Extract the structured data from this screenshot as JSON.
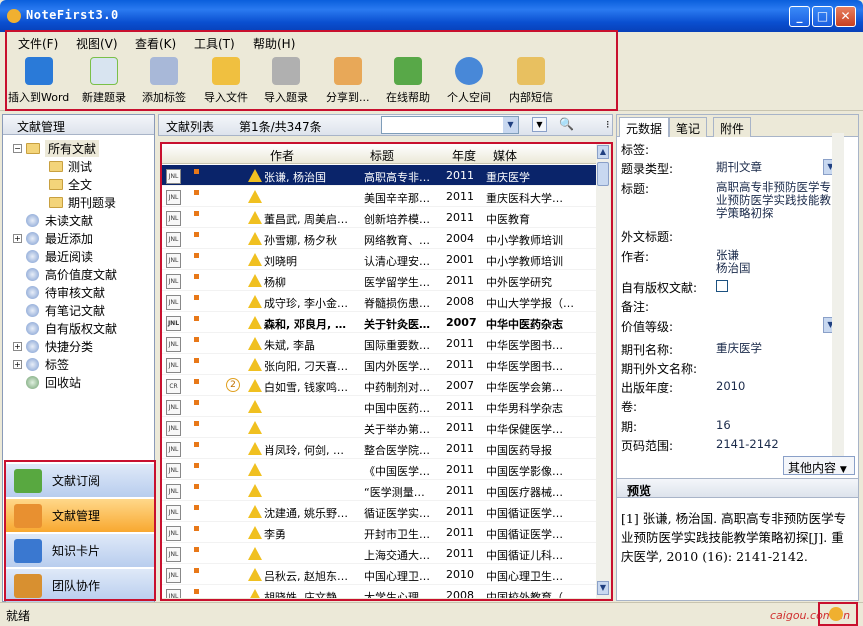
{
  "window": {
    "title": "NoteFirst3.0"
  },
  "menu": [
    "文件(F)",
    "视图(V)",
    "查看(K)",
    "工具(T)",
    "帮助(H)"
  ],
  "toolbar": [
    {
      "label": "插入到Word",
      "icon": "word-insert-icon",
      "color": "#2a7ad8"
    },
    {
      "label": "新建题录",
      "icon": "new-record-icon",
      "color": "#7ac048"
    },
    {
      "label": "添加标签",
      "icon": "tag-icon",
      "color": "#a8b8d8"
    },
    {
      "label": "导入文件",
      "icon": "import-file-icon",
      "color": "#f0c040"
    },
    {
      "label": "导入题录",
      "icon": "import-record-icon",
      "color": "#b0b0b0"
    },
    {
      "label": "分享到...",
      "icon": "share-icon",
      "color": "#e8a858"
    },
    {
      "label": "在线帮助",
      "icon": "help-icon",
      "color": "#58a848"
    },
    {
      "label": "个人空间",
      "icon": "personal-space-icon",
      "color": "#4888d8"
    },
    {
      "label": "内部短信",
      "icon": "message-icon",
      "color": "#e8c060"
    }
  ],
  "left": {
    "header": "文献管理",
    "tree": [
      {
        "label": "所有文献",
        "level": 0,
        "type": "folder",
        "expander": "−"
      },
      {
        "label": "测试",
        "level": 1,
        "type": "folder",
        "expander": ""
      },
      {
        "label": "全文",
        "level": 1,
        "type": "folder",
        "expander": ""
      },
      {
        "label": "期刊题录",
        "level": 1,
        "type": "folder",
        "expander": ""
      },
      {
        "label": "未读文献",
        "level": 0,
        "type": "star",
        "expander": ""
      },
      {
        "label": "最近添加",
        "level": 0,
        "type": "star",
        "expander": "+"
      },
      {
        "label": "最近阅读",
        "level": 0,
        "type": "star",
        "expander": ""
      },
      {
        "label": "高价值度文献",
        "level": 0,
        "type": "star",
        "expander": ""
      },
      {
        "label": "待审核文献",
        "level": 0,
        "type": "star",
        "expander": ""
      },
      {
        "label": "有笔记文献",
        "level": 0,
        "type": "star",
        "expander": ""
      },
      {
        "label": "自有版权文献",
        "level": 0,
        "type": "star",
        "expander": ""
      },
      {
        "label": "快捷分类",
        "level": 0,
        "type": "star",
        "expander": "+"
      },
      {
        "label": "标签",
        "level": 0,
        "type": "star",
        "expander": "+"
      },
      {
        "label": "回收站",
        "level": 0,
        "type": "trash",
        "expander": ""
      }
    ],
    "nav": [
      {
        "label": "文献订阅",
        "active": false
      },
      {
        "label": "文献管理",
        "active": true
      },
      {
        "label": "知识卡片",
        "active": false
      },
      {
        "label": "团队协作",
        "active": false
      }
    ]
  },
  "list": {
    "title": "文献列表",
    "count": "第1条/共347条",
    "columns": {
      "author": "作者",
      "title": "标题",
      "year": "年度",
      "media": "媒体"
    },
    "rows": [
      {
        "type": "JNL",
        "author": "张谦, 杨治国",
        "title": "高职高专非…",
        "year": "2011",
        "media": "重庆医学",
        "sel": true
      },
      {
        "type": "JNL",
        "author": "",
        "title": "美国辛辛那…",
        "year": "2011",
        "media": "重庆医科大学…"
      },
      {
        "type": "JNL",
        "author": "董昌武, 周美启…",
        "title": "创新培养模…",
        "year": "2011",
        "media": "中医教育"
      },
      {
        "type": "JNL",
        "author": "孙雪娜, 杨夕秋",
        "title": "网络教育、…",
        "year": "2004",
        "media": "中小学教师培训"
      },
      {
        "type": "JNL",
        "author": "刘晓明",
        "title": "认清心理安…",
        "year": "2001",
        "media": "中小学教师培训"
      },
      {
        "type": "JNL",
        "author": "杨柳",
        "title": "医学留学生…",
        "year": "2011",
        "media": "中外医学研究"
      },
      {
        "type": "JNL",
        "author": "成守珍, 李小金…",
        "title": "脊髓损伤患…",
        "year": "2008",
        "media": "中山大学学报（…"
      },
      {
        "type": "JNL",
        "author": "森和, 邓良月, …",
        "title": "关于针灸医…",
        "year": "2007",
        "media": "中华中医药杂志",
        "bold": true
      },
      {
        "type": "JNL",
        "author": "朱斌, 李晶",
        "title": "国际重要数…",
        "year": "2011",
        "media": "中华医学图书…"
      },
      {
        "type": "JNL",
        "author": "张向阳, 刁天喜…",
        "title": "国内外医学…",
        "year": "2011",
        "media": "中华医学图书…"
      },
      {
        "type": "CR",
        "author": "白如雪, 钱家鸣…",
        "title": "中药制剂对…",
        "year": "2007",
        "media": "中华医学会第…",
        "badge": "2"
      },
      {
        "type": "JNL",
        "author": "",
        "title": "中国中医药…",
        "year": "2011",
        "media": "中华男科学杂志"
      },
      {
        "type": "JNL",
        "author": "",
        "title": "关于举办第…",
        "year": "2011",
        "media": "中华保健医学…"
      },
      {
        "type": "JNL",
        "author": "肖凤玲, 何剑, …",
        "title": "整合医学院…",
        "year": "2011",
        "media": "中国医药导报"
      },
      {
        "type": "JNL",
        "author": "",
        "title": "《中国医学…",
        "year": "2011",
        "media": "中国医学影像…"
      },
      {
        "type": "JNL",
        "author": "",
        "title": "“医学测量…",
        "year": "2011",
        "media": "中国医疗器械…"
      },
      {
        "type": "JNL",
        "author": "沈建通, 姚乐野…",
        "title": "循证医学实…",
        "year": "2011",
        "media": "中国循证医学…"
      },
      {
        "type": "JNL",
        "author": "李勇",
        "title": "开封市卫生…",
        "year": "2011",
        "media": "中国循证医学…"
      },
      {
        "type": "JNL",
        "author": "",
        "title": "上海交通大…",
        "year": "2011",
        "media": "中国循证儿科…"
      },
      {
        "type": "JNL",
        "author": "吕秋云, 赵旭东…",
        "title": "中国心理卫…",
        "year": "2010",
        "media": "中国心理卫生…"
      },
      {
        "type": "JNL",
        "author": "胡晓姝, 庄文静…",
        "title": "大学生心理…",
        "year": "2008",
        "media": "中国校外教育（…"
      }
    ]
  },
  "right": {
    "tabs": [
      "元数据",
      "笔记",
      "附件"
    ],
    "fields": [
      {
        "label": "标签:",
        "value": ""
      },
      {
        "label": "题录类型:",
        "value": "期刊文章",
        "combo": true
      },
      {
        "label": "标题:",
        "value": "高职高专非预防医学专业预防医学实践技能教学策略初探"
      },
      {
        "label": "外文标题:",
        "value": ""
      },
      {
        "label": "作者:",
        "value": "张谦\n杨治国"
      },
      {
        "label": "自有版权文献:",
        "value": "",
        "checkbox": true
      },
      {
        "label": "备注:",
        "value": ""
      },
      {
        "label": "价值等级:",
        "value": "",
        "combo": true
      },
      {
        "label": "期刊名称:",
        "value": "重庆医学"
      },
      {
        "label": "期刊外文名称:",
        "value": ""
      },
      {
        "label": "出版年度:",
        "value": "2010"
      },
      {
        "label": "卷:",
        "value": ""
      },
      {
        "label": "期:",
        "value": "16"
      },
      {
        "label": "页码范围:",
        "value": "2141-2142"
      }
    ],
    "more_btn": "其他内容",
    "preview_title": "预览",
    "preview_text": "[1] 张谦, 杨治国. 高职高专非预防医学专业预防医学实践技能教学策略初探[J]. 重庆医学, 2010 (16): 2141-2142."
  },
  "status": {
    "text": "就绪",
    "watermark": "caigou.com.cn"
  }
}
